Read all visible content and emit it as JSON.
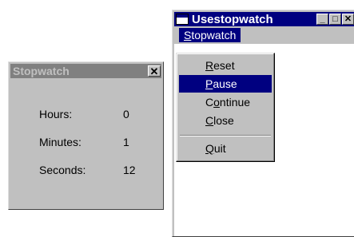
{
  "stopwatch_window": {
    "title": "Stopwatch",
    "close_glyph": "✕",
    "rows": [
      {
        "label": "Hours:",
        "value": "0"
      },
      {
        "label": "Minutes:",
        "value": "1"
      },
      {
        "label": "Seconds:",
        "value": "12"
      }
    ]
  },
  "usestopwatch_window": {
    "title": "Usestopwatch",
    "menubar": {
      "items": [
        {
          "label_first": "S",
          "label_rest": "topwatch"
        }
      ]
    },
    "controls": {
      "minimize_glyph": "_",
      "maximize_glyph": "□",
      "close_glyph": "✕"
    }
  },
  "dropdown": {
    "items": [
      {
        "u": "R",
        "rest": "eset"
      },
      {
        "u": "P",
        "rest": "ause"
      },
      {
        "u": "",
        "pre": "C",
        "u2": "o",
        "rest": "ntinue"
      },
      {
        "u": "C",
        "rest": "lose"
      },
      {
        "u": "Q",
        "rest": "uit"
      }
    ],
    "selected_index": 1
  },
  "colors": {
    "active_title": "#000080",
    "inactive_title": "#808080",
    "face": "#c0c0c0",
    "highlight_text": "#ffffff"
  },
  "icons": {
    "app_icon": "window-icon",
    "close": "close-icon",
    "minimize": "minimize-icon",
    "maximize": "maximize-icon"
  }
}
